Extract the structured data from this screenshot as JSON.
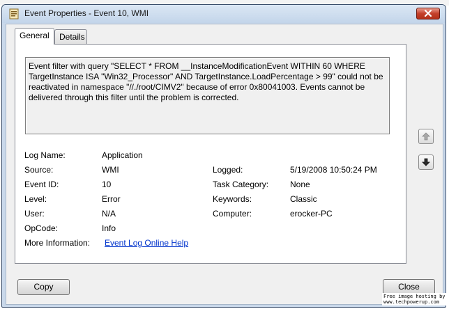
{
  "window": {
    "title": "Event Properties - Event 10, WMI"
  },
  "tabs": [
    {
      "label": "General"
    },
    {
      "label": "Details"
    }
  ],
  "description": "Event filter with query \"SELECT * FROM __InstanceModificationEvent WITHIN 60 WHERE TargetInstance ISA \"Win32_Processor\" AND TargetInstance.LoadPercentage > 99\" could not be reactivated in namespace \"//./root/CIMV2\" because of error 0x80041003. Events cannot be delivered through this filter until the problem is corrected.",
  "fields": {
    "log_name": {
      "label": "Log Name:",
      "value": "Application"
    },
    "source": {
      "label": "Source:",
      "value": "WMI"
    },
    "event_id": {
      "label": "Event ID:",
      "value": "10"
    },
    "level": {
      "label": "Level:",
      "value": "Error"
    },
    "user": {
      "label": "User:",
      "value": "N/A"
    },
    "opcode": {
      "label": "OpCode:",
      "value": "Info"
    },
    "more_info": {
      "label": "More Information:",
      "value": "Event Log Online Help"
    },
    "logged": {
      "label": "Logged:",
      "value": "5/19/2008 10:50:24 PM"
    },
    "task_category": {
      "label": "Task Category:",
      "value": "None"
    },
    "keywords": {
      "label": "Keywords:",
      "value": "Classic"
    },
    "computer": {
      "label": "Computer:",
      "value": "erocker-PC"
    }
  },
  "buttons": {
    "copy": "Copy",
    "close": "Close"
  },
  "watermark": {
    "line1": "Free image hosting by",
    "line2": "www.techpowerup.com"
  },
  "icons": [
    "event-properties-icon",
    "close-icon",
    "arrow-up-icon",
    "arrow-down-icon"
  ]
}
